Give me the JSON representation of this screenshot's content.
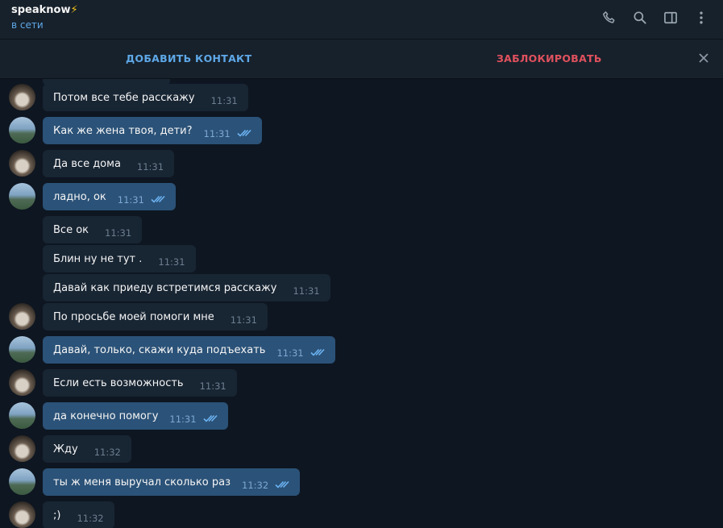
{
  "header": {
    "title": "speaknow",
    "title_badge": "⚡",
    "status": "в сети",
    "icons": [
      "phone-icon",
      "search-icon",
      "sidebar-toggle-icon",
      "more-vertical-icon"
    ]
  },
  "action_bar": {
    "add_contact": "ДОБАВИТЬ КОНТАКТ",
    "block": "ЗАБЛОКИРОВАТЬ"
  },
  "colors": {
    "background": "#0e1621",
    "header": "#17212b",
    "incoming_bubble": "#182533",
    "outgoing_bubble": "#2b5278",
    "accent": "#5ea8e8",
    "danger": "#e0515e"
  },
  "messages": [
    {
      "dir": "in",
      "text": "Потом все тебе расскажу",
      "time": "11:31",
      "avatar": true
    },
    {
      "dir": "out",
      "text": "Как же жена твоя, дети?",
      "time": "11:31",
      "avatar": true
    },
    {
      "dir": "in",
      "text": "Да все дома",
      "time": "11:31",
      "avatar": true
    },
    {
      "dir": "out",
      "text": "ладно, ок",
      "time": "11:31",
      "avatar": true
    },
    {
      "dir": "in",
      "text": "Все ок",
      "time": "11:31",
      "avatar": false
    },
    {
      "dir": "in",
      "text": "Блин ну не тут .",
      "time": "11:31",
      "avatar": false
    },
    {
      "dir": "in",
      "text": "Давай как приеду встретимся расскажу",
      "time": "11:31",
      "avatar": false
    },
    {
      "dir": "in",
      "text": "По просьбе моей помоги мне",
      "time": "11:31",
      "avatar": true
    },
    {
      "dir": "out",
      "text": "Давай, только, скажи куда подъехать",
      "time": "11:31",
      "avatar": true
    },
    {
      "dir": "in",
      "text": "Если есть возможность",
      "time": "11:31",
      "avatar": true
    },
    {
      "dir": "out",
      "text": "да конечно помогу",
      "time": "11:31",
      "avatar": true
    },
    {
      "dir": "in",
      "text": "Жду",
      "time": "11:32",
      "avatar": true
    },
    {
      "dir": "out",
      "text": "ты ж меня выручал сколько раз",
      "time": "11:32",
      "avatar": true
    },
    {
      "dir": "in",
      "text": ";)",
      "time": "11:32",
      "avatar": true
    }
  ]
}
